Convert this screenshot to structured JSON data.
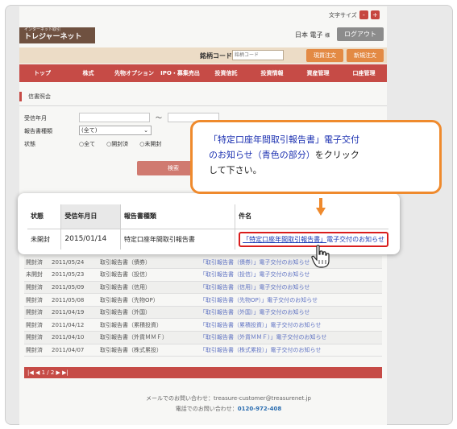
{
  "header": {
    "font_size_label": "文字サイズ",
    "font_minus": "-",
    "font_plus": "+",
    "logo_small": "インターネット取引",
    "logo_big": "トレジャーネット",
    "user_name": "日本 電子",
    "user_suffix": "様",
    "logout_label": "ログアウト"
  },
  "codebar": {
    "label": "銘柄コード",
    "placeholder": "銘柄コード",
    "button_genbutsu": "現買注文",
    "button_shinki": "新規注文"
  },
  "nav": {
    "items": [
      "トップ",
      "株式",
      "先物オプション",
      "IPO・募集売出",
      "投資信託",
      "投資情報",
      "資産管理",
      "口座管理"
    ]
  },
  "section": {
    "title": "信書照会"
  },
  "form": {
    "received_label": "受信年月",
    "tilde": "～",
    "type_label": "報告書種類",
    "type_value": "(全て)",
    "status_label": "状態",
    "status_options": [
      "○全て",
      "○開封済",
      "○未開封"
    ],
    "search_label": "検索"
  },
  "callout": {
    "line1": "「特定口座年間取引報告書」電子交付",
    "line2a": "のお知らせ",
    "line2b": "（青色の部分）",
    "line2c": "をクリック",
    "line3": "して下さい。"
  },
  "highlight_table": {
    "headers": [
      "状態",
      "受信年月日",
      "報告書種類",
      "件名"
    ],
    "row": {
      "status": "未開封",
      "date": "2015/01/14",
      "type": "特定口座年間取引報告書",
      "subject_link": "「特定口座年間取引報告書」",
      "subject_tail": "電子交付のお知らせ"
    }
  },
  "list": [
    {
      "status": "開封済",
      "date": "2011/05/24",
      "type": "取引報告書（債券）",
      "subject": "「取引報告書（債券）」電子交付のお知らせ"
    },
    {
      "status": "未開封",
      "date": "2011/05/23",
      "type": "取引報告書（投信）",
      "subject": "「取引報告書（投信）」電子交付のお知らせ"
    },
    {
      "status": "開封済",
      "date": "2011/05/09",
      "type": "取引報告書（信用）",
      "subject": "「取引報告書（信用）」電子交付のお知らせ"
    },
    {
      "status": "開封済",
      "date": "2011/05/08",
      "type": "取引報告書（先物OP）",
      "subject": "「取引報告書（先物OP）」電子交付のお知らせ"
    },
    {
      "status": "開封済",
      "date": "2011/04/19",
      "type": "取引報告書（外国）",
      "subject": "「取引報告書（外国）」電子交付のお知らせ"
    },
    {
      "status": "開封済",
      "date": "2011/04/12",
      "type": "取引報告書（累積投資）",
      "subject": "「取引報告書（累積投資）」電子交付のお知らせ"
    },
    {
      "status": "開封済",
      "date": "2011/04/10",
      "type": "取引報告書（外貨ＭＭＦ）",
      "subject": "「取引報告書（外貨ＭＭＦ）」電子交付のお知らせ"
    },
    {
      "status": "開封済",
      "date": "2011/04/07",
      "type": "取引報告書（株式累投）",
      "subject": "「取引報告書（株式累投）」電子交付のお知らせ"
    }
  ],
  "pager": {
    "text": "|◀ ◀ 1 / 2 ▶ ▶|"
  },
  "footer": {
    "mail_text": "メールでのお問い合わせ：treasure-customer@treasurenet.jp",
    "phone_label": "電話でのお問い合わせ：",
    "phone_number": "0120-972-408"
  },
  "colors": {
    "accent_red": "#c64b46",
    "callout_orange": "#ef8a2d",
    "link_blue": "#1a3ab5",
    "highlight_border": "#d91d1d"
  }
}
